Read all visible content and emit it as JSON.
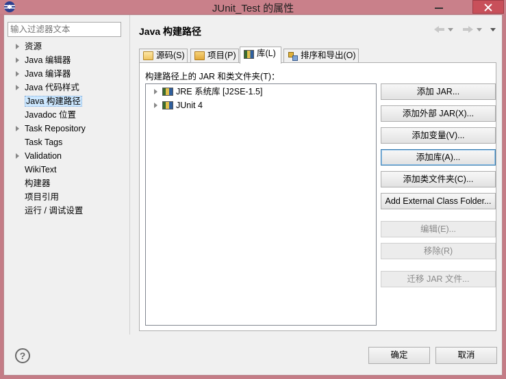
{
  "window": {
    "title": "JUnit_Test 的属性"
  },
  "filter": {
    "placeholder": "输入过滤器文本"
  },
  "nav": {
    "items": [
      {
        "label": "资源",
        "expandable": true
      },
      {
        "label": "Java 编辑器",
        "expandable": true
      },
      {
        "label": "Java 编译器",
        "expandable": true
      },
      {
        "label": "Java 代码样式",
        "expandable": true
      },
      {
        "label": "Java 构建路径",
        "expandable": false,
        "selected": true
      },
      {
        "label": "Javadoc 位置",
        "expandable": false
      },
      {
        "label": "Task Repository",
        "expandable": true
      },
      {
        "label": "Task Tags",
        "expandable": false
      },
      {
        "label": "Validation",
        "expandable": true
      },
      {
        "label": "WikiText",
        "expandable": false
      },
      {
        "label": "构建器",
        "expandable": false
      },
      {
        "label": "项目引用",
        "expandable": false
      },
      {
        "label": "运行 / 调试设置",
        "expandable": false
      }
    ]
  },
  "page": {
    "title": "Java 构建路径",
    "tabs": [
      {
        "label": "源码(S)",
        "icon": "source-folder-icon"
      },
      {
        "label": "项目(P)",
        "icon": "project-folder-icon"
      },
      {
        "label": "库(L)",
        "icon": "library-icon",
        "active": true
      },
      {
        "label": "排序和导出(O)",
        "icon": "order-export-icon"
      }
    ],
    "panel_label": "构建路径上的 JAR 和类文件夹(T)：",
    "tree": [
      {
        "label": "JRE 系统库 [J2SE-1.5]",
        "icon": "library-icon"
      },
      {
        "label": "JUnit 4",
        "icon": "library-icon"
      }
    ],
    "buttons": [
      {
        "label": "添加 JAR...",
        "enabled": true
      },
      {
        "label": "添加外部 JAR(X)...",
        "enabled": true
      },
      {
        "label": "添加变量(V)...",
        "enabled": true
      },
      {
        "label": "添加库(A)...",
        "enabled": true,
        "focused": true
      },
      {
        "label": "添加类文件夹(C)...",
        "enabled": true
      },
      {
        "label": "Add External Class Folder...",
        "enabled": true
      },
      {
        "label": "编辑(E)...",
        "enabled": false
      },
      {
        "label": "移除(R)",
        "enabled": false
      },
      {
        "label": "迁移 JAR 文件...",
        "enabled": false
      }
    ]
  },
  "footer": {
    "help_icon": "?",
    "ok_label": "确定",
    "cancel_label": "取消"
  }
}
